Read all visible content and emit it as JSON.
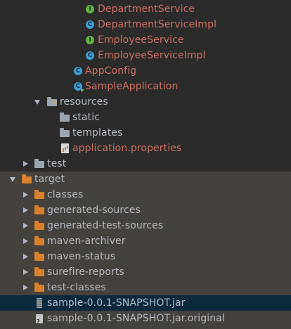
{
  "project_tree": {
    "items": [
      {
        "label": "DepartmentService",
        "kind": "interface",
        "icon": "interface-icon"
      },
      {
        "label": "DepartmentServiceImpl",
        "kind": "class",
        "icon": "class-icon"
      },
      {
        "label": "EmployeeService",
        "kind": "interface",
        "icon": "interface-icon"
      },
      {
        "label": "EmployeeServiceImpl",
        "kind": "class",
        "icon": "class-icon"
      },
      {
        "label": "AppConfig",
        "kind": "class",
        "icon": "class-icon"
      },
      {
        "label": "SampleApplication",
        "kind": "spring-boot-main-class",
        "icon": "spring-boot-class-icon"
      },
      {
        "label": "resources",
        "kind": "resources-folder",
        "expanded": true,
        "icon": "resources-folder-icon"
      },
      {
        "label": "static",
        "kind": "folder",
        "icon": "folder-icon"
      },
      {
        "label": "templates",
        "kind": "folder",
        "icon": "folder-icon"
      },
      {
        "label": "application.properties",
        "kind": "properties-file",
        "icon": "properties-file-icon"
      },
      {
        "label": "test",
        "kind": "folder",
        "expanded": false,
        "icon": "folder-icon"
      },
      {
        "label": "target",
        "kind": "excluded-folder",
        "expanded": true,
        "icon": "excluded-folder-icon"
      },
      {
        "label": "classes",
        "kind": "excluded-folder",
        "expanded": false,
        "icon": "excluded-folder-icon"
      },
      {
        "label": "generated-sources",
        "kind": "excluded-folder",
        "expanded": false,
        "icon": "excluded-folder-icon"
      },
      {
        "label": "generated-test-sources",
        "kind": "excluded-folder",
        "expanded": false,
        "icon": "excluded-folder-icon"
      },
      {
        "label": "maven-archiver",
        "kind": "excluded-folder",
        "expanded": false,
        "icon": "excluded-folder-icon"
      },
      {
        "label": "maven-status",
        "kind": "excluded-folder",
        "expanded": false,
        "icon": "excluded-folder-icon"
      },
      {
        "label": "surefire-reports",
        "kind": "excluded-folder",
        "expanded": false,
        "icon": "excluded-folder-icon"
      },
      {
        "label": "test-classes",
        "kind": "excluded-folder",
        "expanded": false,
        "icon": "excluded-folder-icon"
      },
      {
        "label": "sample-0.0.1-SNAPSHOT.jar",
        "kind": "jar-file",
        "selected": true,
        "icon": "jar-file-icon"
      },
      {
        "label": "sample-0.0.1-SNAPSHOT.jar.original",
        "kind": "unknown-file",
        "icon": "unknown-file-icon"
      }
    ]
  },
  "colors": {
    "background": "#2b2b2b",
    "target_zone_background": "#45423e",
    "selection_background": "#0d293e",
    "modified_text": "#d0705f",
    "normal_text": "#b4bcc6",
    "interface_badge": "#62b543",
    "class_badge": "#3c9ed6",
    "excluded_folder": "#d9822b",
    "folder": "#9aa7b0"
  }
}
